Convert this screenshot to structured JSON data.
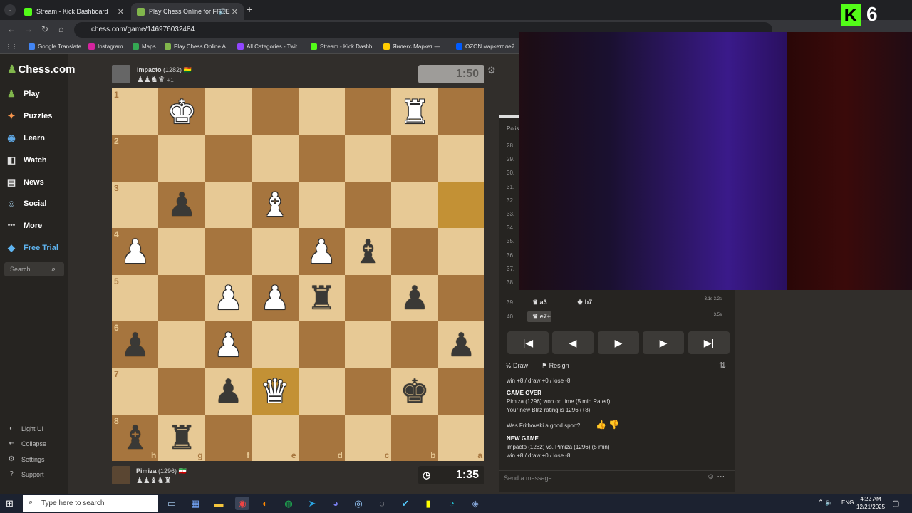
{
  "browser": {
    "tabs": [
      {
        "title": "Stream - Kick Dashboard",
        "favicon_color": "#53fc18"
      },
      {
        "title": "Play Chess Online for FREE",
        "favicon_color": "#81b64c"
      }
    ],
    "url": "chess.com/game/146976032484",
    "bookmarks": [
      "Google Translate",
      "Instagram",
      "Maps",
      "Play Chess Online A...",
      "All Categories - Twit...",
      "Stream - Kick Dashb...",
      "Яндекс Маркет —...",
      "OZON маркетплей..."
    ]
  },
  "sidebar": {
    "logo": "Chess.com",
    "items": [
      {
        "label": "Play",
        "icon": "♟"
      },
      {
        "label": "Puzzles",
        "icon": "✦"
      },
      {
        "label": "Learn",
        "icon": "◉"
      },
      {
        "label": "Watch",
        "icon": "◧"
      },
      {
        "label": "News",
        "icon": "▤"
      },
      {
        "label": "Social",
        "icon": "☺"
      },
      {
        "label": "More",
        "icon": "•••"
      },
      {
        "label": "Free Trial",
        "icon": "◆"
      }
    ],
    "search_placeholder": "Search",
    "bottom": [
      {
        "label": "Light UI",
        "icon": "◐"
      },
      {
        "label": "Collapse",
        "icon": "⇤"
      },
      {
        "label": "Settings",
        "icon": "⚙"
      },
      {
        "label": "Support",
        "icon": "?"
      }
    ]
  },
  "top_player": {
    "name": "impacto",
    "rating": "(1282)",
    "flag": "🇧🇴",
    "captured": "♟♟♞♛",
    "bonus": "+1",
    "clock": "1:50"
  },
  "bottom_player": {
    "name": "Pimiza",
    "rating": "(1296)",
    "flag": "🇮🇷",
    "captured": "♟♟♝♞♜",
    "clock": "1:35"
  },
  "board": {
    "orientation": "black",
    "ranks": [
      "1",
      "2",
      "3",
      "4",
      "5",
      "6",
      "7",
      "8"
    ],
    "files": [
      "h",
      "g",
      "f",
      "e",
      "d",
      "c",
      "b",
      "a"
    ],
    "rows": [
      [
        "",
        "wK",
        "",
        "",
        "",
        "",
        "wR",
        ""
      ],
      [
        "",
        "",
        "",
        "",
        "",
        "",
        "",
        ""
      ],
      [
        "",
        "bP",
        "",
        "wB",
        "",
        "",
        "",
        ""
      ],
      [
        "wP",
        "",
        "",
        "",
        "wP",
        "bB",
        "",
        ""
      ],
      [
        "",
        "",
        "wP",
        "wP",
        "bR",
        "",
        "bP",
        ""
      ],
      [
        "bP",
        "",
        "wP",
        "",
        "",
        "",
        "",
        "bP"
      ],
      [
        "",
        "",
        "bP",
        "wQ",
        "",
        "",
        "bK",
        ""
      ],
      [
        "bB",
        "bR",
        "",
        "",
        "",
        "",
        "",
        ""
      ]
    ],
    "highlights": [
      [
        2,
        7
      ],
      [
        6,
        3
      ]
    ]
  },
  "panel": {
    "tab_label": "Polis",
    "move_numbers": [
      "28.",
      "29.",
      "30.",
      "31.",
      "32.",
      "33.",
      "34.",
      "35.",
      "36.",
      "37.",
      "38."
    ],
    "moves": [
      {
        "num": "39.",
        "white": "a3",
        "black": "b7",
        "time": "3.1s 3.2s"
      },
      {
        "num": "40.",
        "white": "e7+",
        "black": "",
        "time": "3.5s"
      }
    ],
    "controls": [
      "|◀",
      "◀",
      "▶",
      "▶",
      "▶|"
    ],
    "draw_label": "Draw",
    "resign_label": "Resign",
    "log_lines": [
      "win +8 / draw +0 / lose -8",
      "GAME OVER",
      "Pimiza (1296) won on time (5 min Rated)",
      "Your new Blitz rating is 1296 (+8).",
      "Was Frithovski a good sport?",
      "NEW GAME",
      "impacto (1282) vs. Pimiza (1296) (5 min)",
      "win +8 / draw +0 / lose -8"
    ],
    "message_placeholder": "Send a message..."
  },
  "overlay": {
    "kick_number": "6"
  },
  "taskbar": {
    "search_placeholder": "Type here to search",
    "lang": "ENG",
    "time": "4:22 AM",
    "date": "12/21/2025"
  }
}
